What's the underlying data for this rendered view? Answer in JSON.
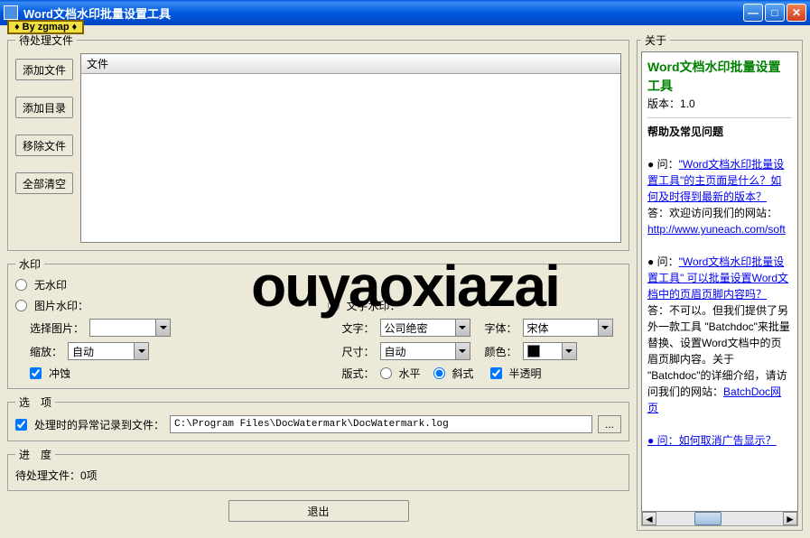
{
  "window": {
    "title": "Word文档水印批量设置工具"
  },
  "tag": "♦ By zgmap ♦",
  "files": {
    "legend": "待处理文件",
    "header": "文件",
    "btn_add_file": "添加文件",
    "btn_add_dir": "添加目录",
    "btn_remove": "移除文件",
    "btn_clear": "全部清空"
  },
  "watermark": {
    "legend": "水印",
    "none": "无水印",
    "image": "图片水印：",
    "select_image": "选择图片：",
    "scale": "缩放：",
    "scale_val": "自动",
    "washout": "冲蚀",
    "text": "文字水印：",
    "text_lbl": "文字：",
    "text_val": "公司绝密",
    "font_lbl": "字体：",
    "font_val": "宋体",
    "size_lbl": "尺寸：",
    "size_val": "自动",
    "color_lbl": "颜色：",
    "layout_lbl": "版式：",
    "horiz": "水平",
    "diag": "斜式",
    "semi": "半透明"
  },
  "options": {
    "legend": "选　项",
    "log_chk": "处理时的异常记录到文件：",
    "log_path": "C:\\Program Files\\DocWatermark\\DocWatermark.log"
  },
  "progress": {
    "legend": "进　度",
    "pending": "待处理文件：0项"
  },
  "buttons": {
    "exit": "退出"
  },
  "about": {
    "legend": "关于",
    "title": "Word文档水印批量设置工具",
    "version_lbl": "版本：",
    "version": "1.0",
    "help_title": "帮助及常见问题",
    "q1_prefix": "● 问：",
    "q1": "\"Word文档水印批量设置工具\"的主页面是什么？如何及时得到最新的版本？",
    "a1": "答：欢迎访问我们的网站：",
    "link1": "http://www.yuneach.com/soft",
    "q2": "\"Word文档水印批量设置工具\" 可以批量设置Word文档中的页眉页脚内容吗？",
    "a2a": "答：不可以。但我们提供了另外一款工具 \"Batchdoc\"来批量替换、设置Word文档中的页眉页脚内容。关于 \"Batchdoc\"的详细介绍，请访问我们的网站：",
    "link2": "BatchDoc网页",
    "q3": "● 问：如何取消广告显示？"
  },
  "overlay": "ouyaoxiazai"
}
